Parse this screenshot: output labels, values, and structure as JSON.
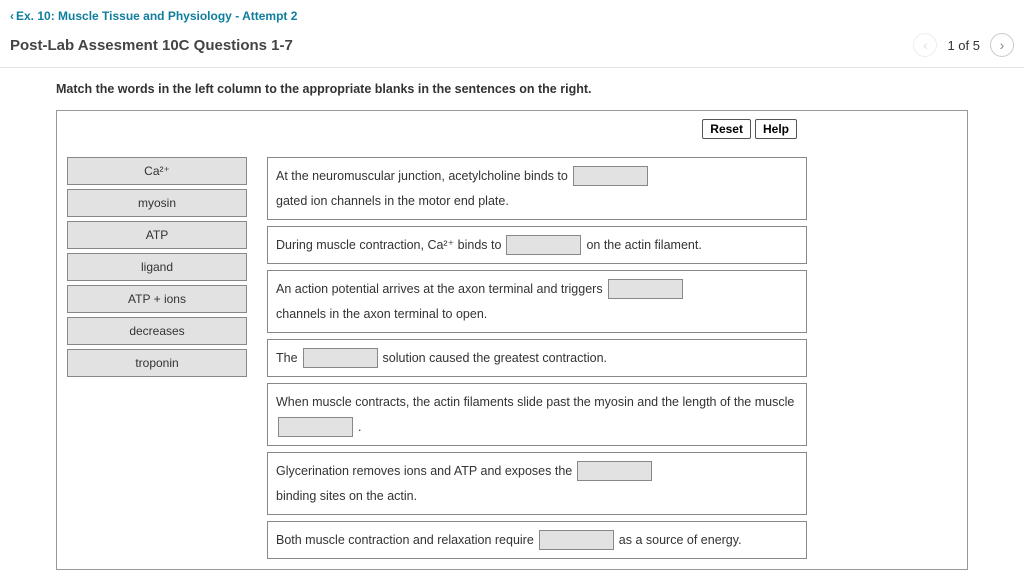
{
  "breadcrumb": {
    "chevron": "‹",
    "label": "Ex. 10: Muscle Tissue and Physiology - Attempt 2"
  },
  "pageTitle": "Post-Lab Assesment 10C Questions 1-7",
  "progress": "1 of 5",
  "instruction": "Match the words in the left column to the appropriate blanks in the sentences on the right.",
  "buttons": {
    "reset": "Reset",
    "help": "Help"
  },
  "terms": [
    "Ca²⁺",
    "myosin",
    "ATP",
    "ligand",
    "ATP + ions",
    "decreases",
    "troponin"
  ],
  "sentences": {
    "s1a": "At the neuromuscular junction, acetylcholine binds to",
    "s1b": "gated ion channels in the motor end plate.",
    "s2a": "During muscle contraction, Ca²⁺ binds to",
    "s2b": "on the actin filament.",
    "s3a": "An action potential arrives at the axon terminal and triggers",
    "s3b": "channels in the axon terminal to open.",
    "s4a": "The",
    "s4b": "solution caused the greatest contraction.",
    "s5a": "When muscle contracts, the actin filaments slide past the myosin and the length of the muscle",
    "s5b": ".",
    "s6a": "Glycerination removes ions and ATP and exposes the",
    "s6b": "binding sites on the actin.",
    "s7a": "Both muscle contraction and relaxation require",
    "s7b": "as a source of energy."
  }
}
